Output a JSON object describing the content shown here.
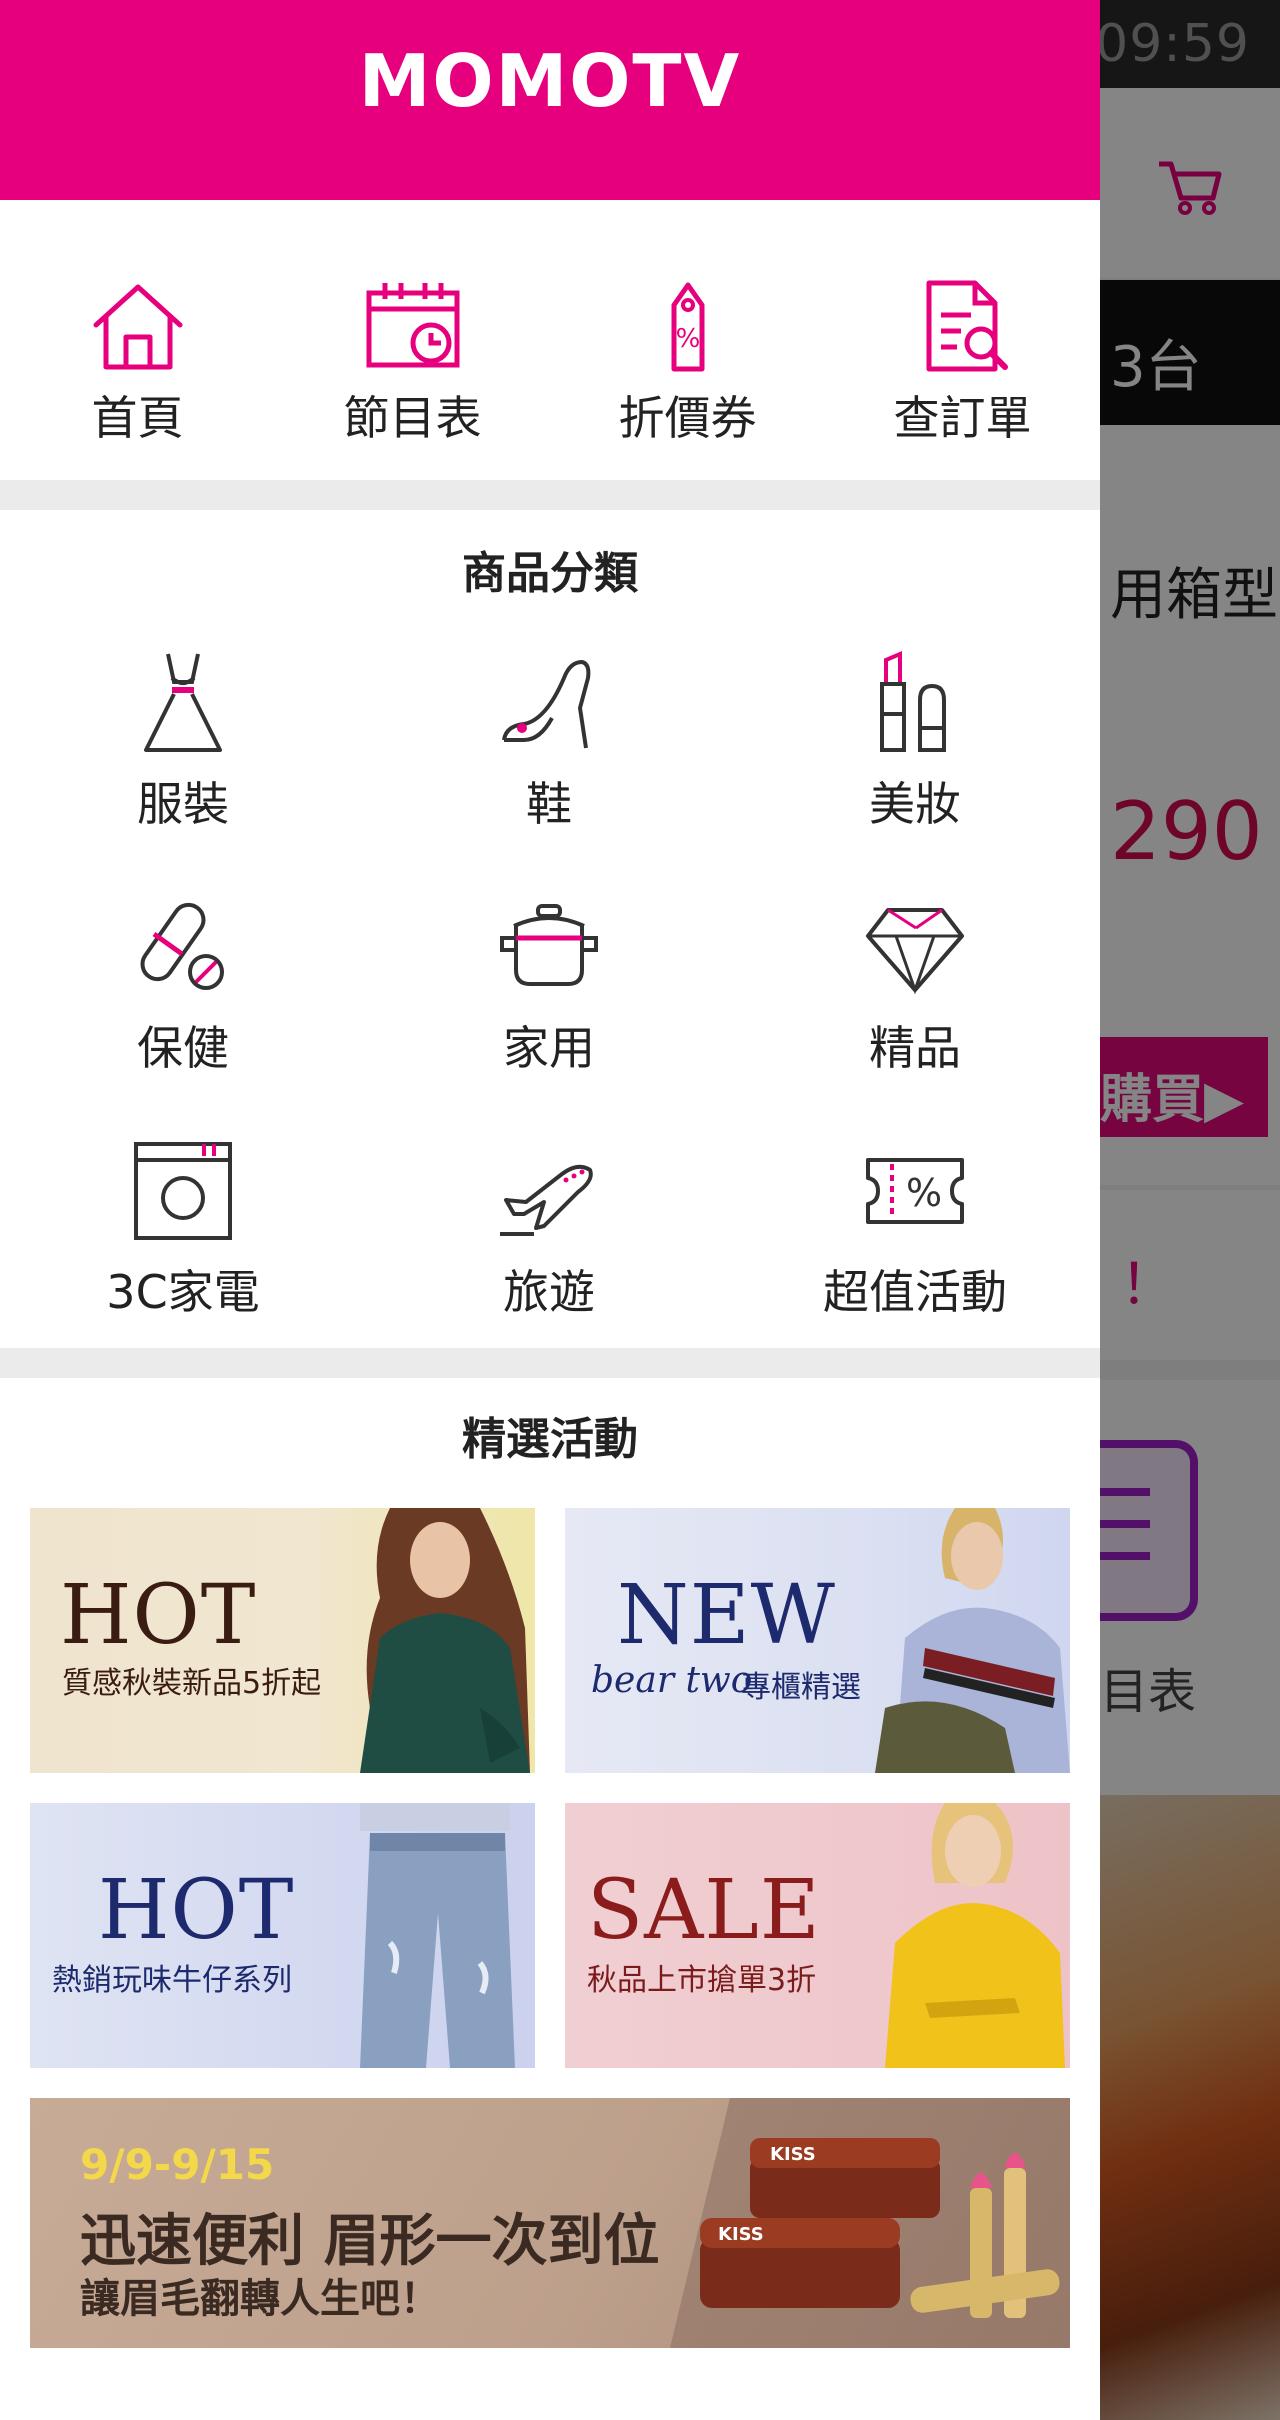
{
  "status_bar": {
    "time": "09:59"
  },
  "background_page": {
    "channel_text": "3台",
    "product_fragment": "用箱型",
    "price_fragment": "290",
    "buy_fragment": "購買▶",
    "notice_fragment": "！",
    "schedule_fragment": "目表"
  },
  "drawer": {
    "brand": "MOMOTV",
    "quick_nav": [
      {
        "label": "首頁",
        "icon": "home-icon"
      },
      {
        "label": "節目表",
        "icon": "calendar-clock-icon"
      },
      {
        "label": "折價券",
        "icon": "coupon-tag-icon"
      },
      {
        "label": "查訂單",
        "icon": "order-search-icon"
      }
    ],
    "categories": {
      "title": "商品分類",
      "items": [
        {
          "label": "服裝",
          "icon": "dress-icon"
        },
        {
          "label": "鞋",
          "icon": "high-heel-icon"
        },
        {
          "label": "美妝",
          "icon": "lipstick-icon"
        },
        {
          "label": "保健",
          "icon": "pill-icon"
        },
        {
          "label": "家用",
          "icon": "pot-icon"
        },
        {
          "label": "精品",
          "icon": "diamond-icon"
        },
        {
          "label": "3C家電",
          "icon": "washing-machine-icon"
        },
        {
          "label": "旅遊",
          "icon": "airplane-icon"
        },
        {
          "label": "超值活動",
          "icon": "percent-ticket-icon"
        }
      ]
    },
    "featured": {
      "title": "精選活動",
      "banners": [
        {
          "headline": "HOT",
          "sub": "質感秋裝新品5折起"
        },
        {
          "headline": "NEW",
          "sub_script": "bear two",
          "sub": "專櫃精選"
        },
        {
          "headline": "HOT",
          "sub": "熱銷玩味牛仔系列"
        },
        {
          "headline": "SALE",
          "sub": "秋品上市搶單3折"
        },
        {
          "date": "9/9-9/15",
          "headline": "迅速便利 眉形一次到位",
          "sub": "讓眉毛翻轉人生吧！",
          "product_label": "KISS"
        }
      ]
    }
  },
  "colors": {
    "brand": "#e6007e",
    "icon_stroke": "#333333",
    "icon_accent": "#e6007e"
  }
}
